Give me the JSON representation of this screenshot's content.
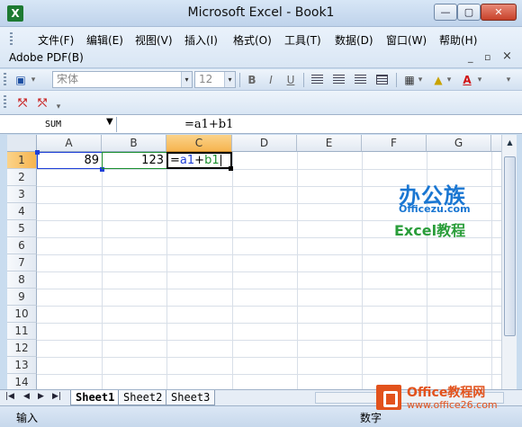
{
  "window": {
    "title": "Microsoft Excel - Book1",
    "app_icon": "X",
    "minimize": "—",
    "restore": "▢",
    "close": "✕"
  },
  "menu": {
    "items": [
      "文件(F)",
      "编辑(E)",
      "视图(V)",
      "插入(I)",
      "格式(O)",
      "工具(T)",
      "数据(D)",
      "窗口(W)",
      "帮助(H)"
    ],
    "adobe": "Adobe PDF(B)",
    "mdi_minimize": "_",
    "mdi_restore": "▫",
    "mdi_close": "×"
  },
  "toolbar": {
    "font_name": "宋体",
    "font_size": "12",
    "bold": "B",
    "italic": "I",
    "underline": "U",
    "font_color_letter": "A",
    "dropdown_arrow": "▾"
  },
  "formula_bar": {
    "name_box": "SUM",
    "formula": "=a1+b1"
  },
  "grid": {
    "columns": [
      "A",
      "B",
      "C",
      "D",
      "E",
      "F",
      "G"
    ],
    "active_column": "C",
    "rows": [
      "1",
      "2",
      "3",
      "4",
      "5",
      "6",
      "7",
      "8",
      "9",
      "10",
      "11",
      "12",
      "13",
      "14"
    ],
    "active_row": "1",
    "cells": {
      "A1": "89",
      "B1": "123",
      "C1_prefix": "=",
      "C1_ref_a": "a1",
      "C1_plus": "+",
      "C1_ref_b": "b1"
    },
    "colors": {
      "ref_a": "#1e3fd8",
      "ref_b": "#1a8f2e"
    }
  },
  "watermark": {
    "line1": "办公族",
    "line2": "Officezu.com",
    "line3": "Excel教程"
  },
  "sheets": {
    "tabs": [
      "Sheet1",
      "Sheet2",
      "Sheet3"
    ],
    "active": "Sheet1",
    "nav": [
      "|◀",
      "◀",
      "▶",
      "▶|"
    ]
  },
  "status": {
    "mode": "输入",
    "num": "数字"
  },
  "badge": {
    "title": "Office教程网",
    "url": "www.office26.com"
  }
}
